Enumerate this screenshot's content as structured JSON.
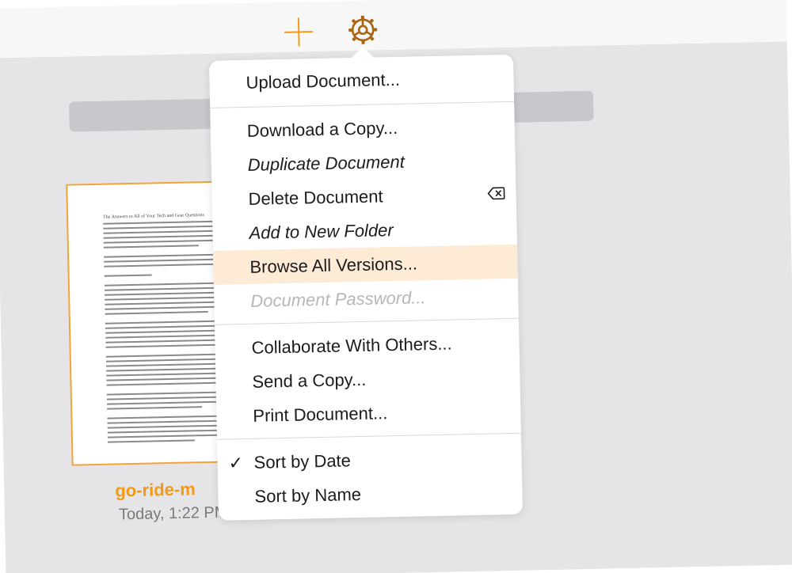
{
  "toolbar": {
    "icons": [
      "plus-icon",
      "gear-icon"
    ],
    "accent_color": "#f09a16"
  },
  "document": {
    "name": "go-ride-m",
    "date": "Today, 1:22 PM",
    "preview_title": "The Answers to All of Your Tech and Gear Questions"
  },
  "menu": {
    "upload": "Upload Document...",
    "download": "Download a Copy...",
    "duplicate": "Duplicate Document",
    "delete": "Delete Document",
    "add_folder": "Add to New Folder",
    "browse_versions": "Browse All Versions...",
    "password": "Document Password...",
    "collaborate": "Collaborate With Others...",
    "send_copy": "Send a Copy...",
    "print": "Print Document...",
    "sort_date": "Sort by Date",
    "sort_name": "Sort by Name",
    "sort_selected": "Sort by Date",
    "highlight_color": "#fdebd6"
  }
}
